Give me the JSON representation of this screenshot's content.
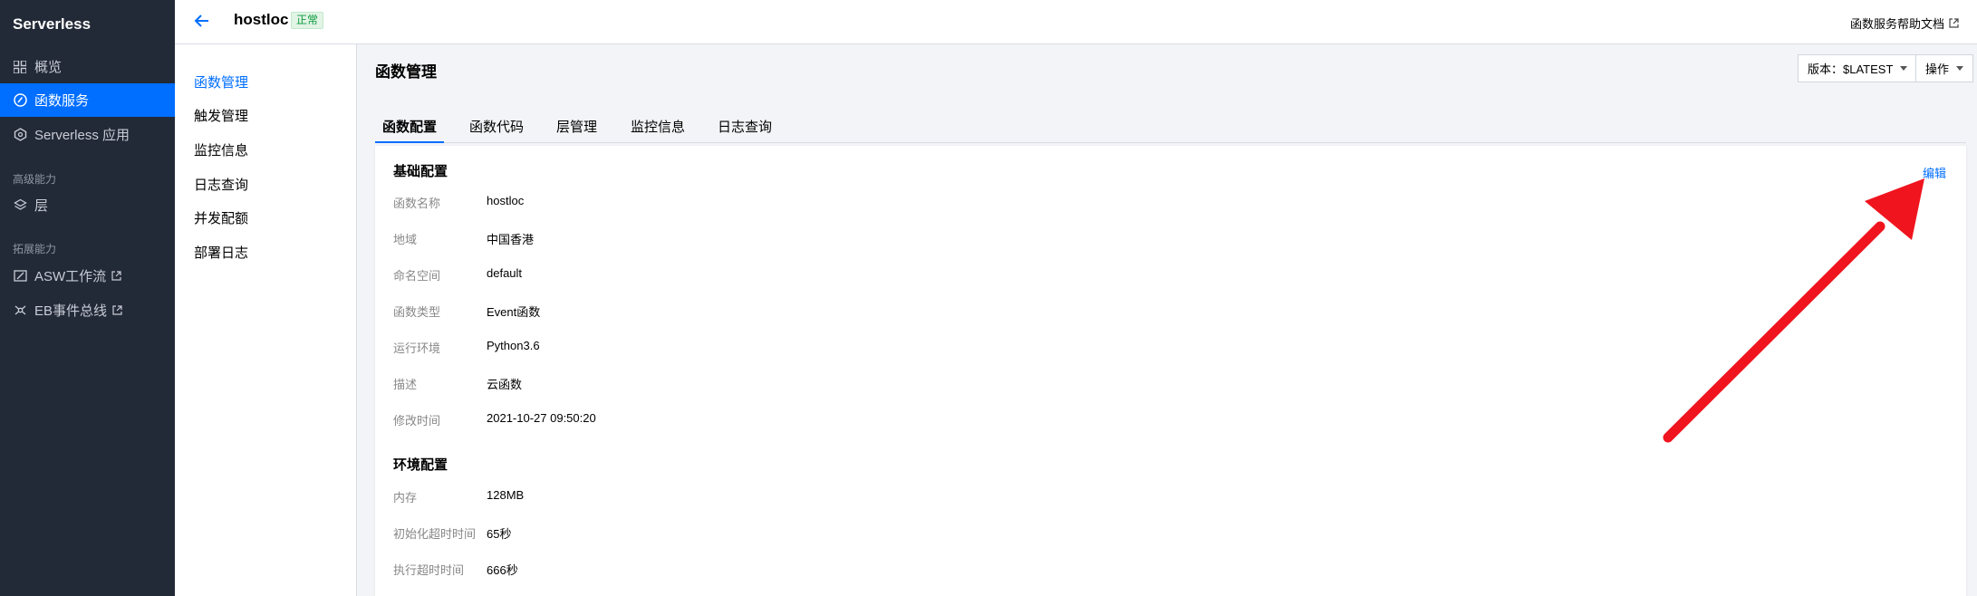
{
  "sidebar": {
    "title": "Serverless",
    "items": [
      {
        "label": "概览",
        "icon": "grid-icon"
      },
      {
        "label": "函数服务",
        "icon": "function-icon"
      },
      {
        "label": "Serverless 应用",
        "icon": "app-icon"
      }
    ],
    "group_advanced": "高级能力",
    "layer_label": "层",
    "group_extend": "拓展能力",
    "asw_label": "ASW工作流",
    "eb_label": "EB事件总线"
  },
  "header": {
    "function_name": "hostloc",
    "status": "正常",
    "help_link": "函数服务帮助文档"
  },
  "subnav": {
    "items": [
      "函数管理",
      "触发管理",
      "监控信息",
      "日志查询",
      "并发配额",
      "部署日志"
    ]
  },
  "main": {
    "title": "函数管理",
    "version_button": "版本：$LATEST",
    "action_button": "操作",
    "tabs": [
      "函数配置",
      "函数代码",
      "层管理",
      "监控信息",
      "日志查询"
    ]
  },
  "basic": {
    "title": "基础配置",
    "edit": "编辑",
    "rows": [
      {
        "label": "函数名称",
        "value": "hostloc"
      },
      {
        "label": "地域",
        "value": "中国香港"
      },
      {
        "label": "命名空间",
        "value": "default"
      },
      {
        "label": "函数类型",
        "value": "Event函数"
      },
      {
        "label": "运行环境",
        "value": "Python3.6"
      },
      {
        "label": "描述",
        "value": "云函数"
      },
      {
        "label": "修改时间",
        "value": "2021-10-27 09:50:20"
      }
    ]
  },
  "env": {
    "title": "环境配置",
    "rows": [
      {
        "label": "内存",
        "value": "128MB"
      },
      {
        "label": "初始化超时时间",
        "value": "65秒"
      },
      {
        "label": "执行超时时间",
        "value": "666秒"
      }
    ]
  },
  "colors": {
    "accent": "#006eff",
    "sidebar_bg": "#232a37",
    "annotation_arrow": "#f0141e"
  }
}
